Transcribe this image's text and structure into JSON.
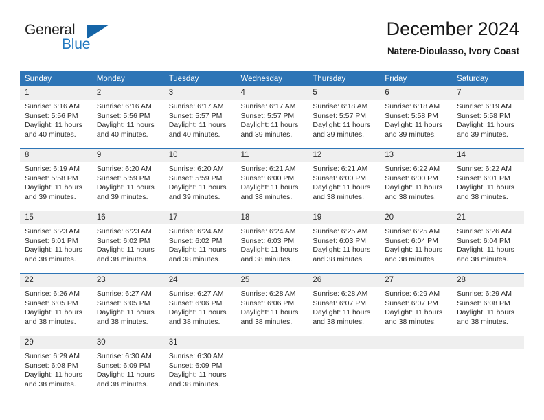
{
  "brand": {
    "name_part1": "General",
    "name_part2": "Blue",
    "logo_icon": "triangle-logo-icon"
  },
  "header": {
    "title": "December 2024",
    "subtitle": "Natere-Dioulasso, Ivory Coast"
  },
  "calendar": {
    "weekday_headers": [
      "Sunday",
      "Monday",
      "Tuesday",
      "Wednesday",
      "Thursday",
      "Friday",
      "Saturday"
    ],
    "colors": {
      "header_bg": "#2e75b6",
      "header_text": "#ffffff",
      "daynum_bg": "#efefef",
      "row_divider": "#2e75b6",
      "brand_blue": "#2278bf",
      "logo_blue": "#1565a8"
    },
    "weeks": [
      [
        {
          "day": "1",
          "sunrise": "Sunrise: 6:16 AM",
          "sunset": "Sunset: 5:56 PM",
          "daylight_line1": "Daylight: 11 hours",
          "daylight_line2": "and 40 minutes."
        },
        {
          "day": "2",
          "sunrise": "Sunrise: 6:16 AM",
          "sunset": "Sunset: 5:56 PM",
          "daylight_line1": "Daylight: 11 hours",
          "daylight_line2": "and 40 minutes."
        },
        {
          "day": "3",
          "sunrise": "Sunrise: 6:17 AM",
          "sunset": "Sunset: 5:57 PM",
          "daylight_line1": "Daylight: 11 hours",
          "daylight_line2": "and 40 minutes."
        },
        {
          "day": "4",
          "sunrise": "Sunrise: 6:17 AM",
          "sunset": "Sunset: 5:57 PM",
          "daylight_line1": "Daylight: 11 hours",
          "daylight_line2": "and 39 minutes."
        },
        {
          "day": "5",
          "sunrise": "Sunrise: 6:18 AM",
          "sunset": "Sunset: 5:57 PM",
          "daylight_line1": "Daylight: 11 hours",
          "daylight_line2": "and 39 minutes."
        },
        {
          "day": "6",
          "sunrise": "Sunrise: 6:18 AM",
          "sunset": "Sunset: 5:58 PM",
          "daylight_line1": "Daylight: 11 hours",
          "daylight_line2": "and 39 minutes."
        },
        {
          "day": "7",
          "sunrise": "Sunrise: 6:19 AM",
          "sunset": "Sunset: 5:58 PM",
          "daylight_line1": "Daylight: 11 hours",
          "daylight_line2": "and 39 minutes."
        }
      ],
      [
        {
          "day": "8",
          "sunrise": "Sunrise: 6:19 AM",
          "sunset": "Sunset: 5:58 PM",
          "daylight_line1": "Daylight: 11 hours",
          "daylight_line2": "and 39 minutes."
        },
        {
          "day": "9",
          "sunrise": "Sunrise: 6:20 AM",
          "sunset": "Sunset: 5:59 PM",
          "daylight_line1": "Daylight: 11 hours",
          "daylight_line2": "and 39 minutes."
        },
        {
          "day": "10",
          "sunrise": "Sunrise: 6:20 AM",
          "sunset": "Sunset: 5:59 PM",
          "daylight_line1": "Daylight: 11 hours",
          "daylight_line2": "and 39 minutes."
        },
        {
          "day": "11",
          "sunrise": "Sunrise: 6:21 AM",
          "sunset": "Sunset: 6:00 PM",
          "daylight_line1": "Daylight: 11 hours",
          "daylight_line2": "and 38 minutes."
        },
        {
          "day": "12",
          "sunrise": "Sunrise: 6:21 AM",
          "sunset": "Sunset: 6:00 PM",
          "daylight_line1": "Daylight: 11 hours",
          "daylight_line2": "and 38 minutes."
        },
        {
          "day": "13",
          "sunrise": "Sunrise: 6:22 AM",
          "sunset": "Sunset: 6:00 PM",
          "daylight_line1": "Daylight: 11 hours",
          "daylight_line2": "and 38 minutes."
        },
        {
          "day": "14",
          "sunrise": "Sunrise: 6:22 AM",
          "sunset": "Sunset: 6:01 PM",
          "daylight_line1": "Daylight: 11 hours",
          "daylight_line2": "and 38 minutes."
        }
      ],
      [
        {
          "day": "15",
          "sunrise": "Sunrise: 6:23 AM",
          "sunset": "Sunset: 6:01 PM",
          "daylight_line1": "Daylight: 11 hours",
          "daylight_line2": "and 38 minutes."
        },
        {
          "day": "16",
          "sunrise": "Sunrise: 6:23 AM",
          "sunset": "Sunset: 6:02 PM",
          "daylight_line1": "Daylight: 11 hours",
          "daylight_line2": "and 38 minutes."
        },
        {
          "day": "17",
          "sunrise": "Sunrise: 6:24 AM",
          "sunset": "Sunset: 6:02 PM",
          "daylight_line1": "Daylight: 11 hours",
          "daylight_line2": "and 38 minutes."
        },
        {
          "day": "18",
          "sunrise": "Sunrise: 6:24 AM",
          "sunset": "Sunset: 6:03 PM",
          "daylight_line1": "Daylight: 11 hours",
          "daylight_line2": "and 38 minutes."
        },
        {
          "day": "19",
          "sunrise": "Sunrise: 6:25 AM",
          "sunset": "Sunset: 6:03 PM",
          "daylight_line1": "Daylight: 11 hours",
          "daylight_line2": "and 38 minutes."
        },
        {
          "day": "20",
          "sunrise": "Sunrise: 6:25 AM",
          "sunset": "Sunset: 6:04 PM",
          "daylight_line1": "Daylight: 11 hours",
          "daylight_line2": "and 38 minutes."
        },
        {
          "day": "21",
          "sunrise": "Sunrise: 6:26 AM",
          "sunset": "Sunset: 6:04 PM",
          "daylight_line1": "Daylight: 11 hours",
          "daylight_line2": "and 38 minutes."
        }
      ],
      [
        {
          "day": "22",
          "sunrise": "Sunrise: 6:26 AM",
          "sunset": "Sunset: 6:05 PM",
          "daylight_line1": "Daylight: 11 hours",
          "daylight_line2": "and 38 minutes."
        },
        {
          "day": "23",
          "sunrise": "Sunrise: 6:27 AM",
          "sunset": "Sunset: 6:05 PM",
          "daylight_line1": "Daylight: 11 hours",
          "daylight_line2": "and 38 minutes."
        },
        {
          "day": "24",
          "sunrise": "Sunrise: 6:27 AM",
          "sunset": "Sunset: 6:06 PM",
          "daylight_line1": "Daylight: 11 hours",
          "daylight_line2": "and 38 minutes."
        },
        {
          "day": "25",
          "sunrise": "Sunrise: 6:28 AM",
          "sunset": "Sunset: 6:06 PM",
          "daylight_line1": "Daylight: 11 hours",
          "daylight_line2": "and 38 minutes."
        },
        {
          "day": "26",
          "sunrise": "Sunrise: 6:28 AM",
          "sunset": "Sunset: 6:07 PM",
          "daylight_line1": "Daylight: 11 hours",
          "daylight_line2": "and 38 minutes."
        },
        {
          "day": "27",
          "sunrise": "Sunrise: 6:29 AM",
          "sunset": "Sunset: 6:07 PM",
          "daylight_line1": "Daylight: 11 hours",
          "daylight_line2": "and 38 minutes."
        },
        {
          "day": "28",
          "sunrise": "Sunrise: 6:29 AM",
          "sunset": "Sunset: 6:08 PM",
          "daylight_line1": "Daylight: 11 hours",
          "daylight_line2": "and 38 minutes."
        }
      ],
      [
        {
          "day": "29",
          "sunrise": "Sunrise: 6:29 AM",
          "sunset": "Sunset: 6:08 PM",
          "daylight_line1": "Daylight: 11 hours",
          "daylight_line2": "and 38 minutes."
        },
        {
          "day": "30",
          "sunrise": "Sunrise: 6:30 AM",
          "sunset": "Sunset: 6:09 PM",
          "daylight_line1": "Daylight: 11 hours",
          "daylight_line2": "and 38 minutes."
        },
        {
          "day": "31",
          "sunrise": "Sunrise: 6:30 AM",
          "sunset": "Sunset: 6:09 PM",
          "daylight_line1": "Daylight: 11 hours",
          "daylight_line2": "and 38 minutes."
        },
        {
          "day": "",
          "sunrise": "",
          "sunset": "",
          "daylight_line1": "",
          "daylight_line2": ""
        },
        {
          "day": "",
          "sunrise": "",
          "sunset": "",
          "daylight_line1": "",
          "daylight_line2": ""
        },
        {
          "day": "",
          "sunrise": "",
          "sunset": "",
          "daylight_line1": "",
          "daylight_line2": ""
        },
        {
          "day": "",
          "sunrise": "",
          "sunset": "",
          "daylight_line1": "",
          "daylight_line2": ""
        }
      ]
    ]
  }
}
